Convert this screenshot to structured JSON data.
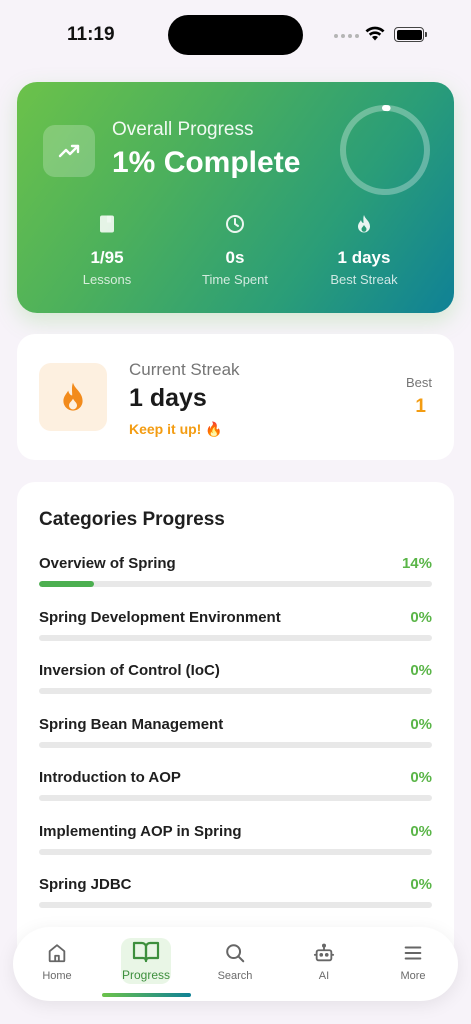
{
  "status_bar": {
    "time": "11:19"
  },
  "overall": {
    "label": "Overall Progress",
    "value": "1% Complete",
    "progress_fraction": 0.01,
    "stats": [
      {
        "icon": "book-icon",
        "value": "1/95",
        "label": "Lessons"
      },
      {
        "icon": "clock-icon",
        "value": "0s",
        "label": "Time Spent"
      },
      {
        "icon": "flame-icon",
        "value": "1 days",
        "label": "Best Streak"
      }
    ]
  },
  "streak": {
    "label": "Current Streak",
    "value": "1 days",
    "message": "Keep it up! 🔥",
    "best_label": "Best",
    "best_value": "1"
  },
  "categories": {
    "title": "Categories Progress",
    "items": [
      {
        "name": "Overview of Spring",
        "percent": "14%",
        "fraction": 0.14
      },
      {
        "name": "Spring Development Environment",
        "percent": "0%",
        "fraction": 0
      },
      {
        "name": "Inversion of Control (IoC)",
        "percent": "0%",
        "fraction": 0
      },
      {
        "name": "Spring Bean Management",
        "percent": "0%",
        "fraction": 0
      },
      {
        "name": "Introduction to AOP",
        "percent": "0%",
        "fraction": 0
      },
      {
        "name": "Implementing AOP in Spring",
        "percent": "0%",
        "fraction": 0
      },
      {
        "name": "Spring JDBC",
        "percent": "0%",
        "fraction": 0
      }
    ]
  },
  "nav": {
    "items": [
      {
        "label": "Home",
        "icon": "home-icon"
      },
      {
        "label": "Progress",
        "icon": "book-open-icon",
        "active": true
      },
      {
        "label": "Search",
        "icon": "search-icon"
      },
      {
        "label": "AI",
        "icon": "robot-icon"
      },
      {
        "label": "More",
        "icon": "menu-icon"
      }
    ]
  },
  "colors": {
    "gradient_start": "#6cc24a",
    "gradient_end": "#0f8196",
    "accent_green": "#5ab548",
    "accent_orange": "#f39c12"
  }
}
